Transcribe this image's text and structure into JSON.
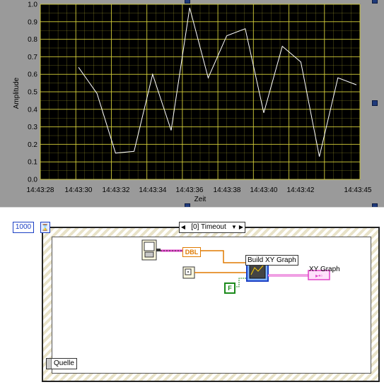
{
  "front_panel": {
    "graph_label": "XY Graph"
  },
  "chart_data": {
    "type": "line",
    "x": [
      "14:43:30",
      "14:43:31",
      "14:43:32",
      "14:43:33",
      "14:43:34",
      "14:43:35",
      "14:43:36",
      "14:43:37",
      "14:43:38",
      "14:43:39",
      "14:43:40",
      "14:43:41",
      "14:43:42",
      "14:43:43",
      "14:43:44",
      "14:43:45"
    ],
    "y": [
      0.64,
      0.49,
      0.15,
      0.16,
      0.6,
      0.28,
      0.98,
      0.58,
      0.82,
      0.86,
      0.38,
      0.76,
      0.67,
      0.13,
      0.58,
      0.54
    ],
    "xlabel": "Zeit",
    "ylabel": "Amplitude",
    "x_tick_labels": [
      "14:43:28",
      "14:43:30",
      "14:43:32",
      "14:43:34",
      "14:43:36",
      "14:43:38",
      "14:43:40",
      "14:43:42",
      "14:43:45"
    ],
    "y_tick_labels": [
      "0.0",
      "0.1",
      "0.2",
      "0.3",
      "0.4",
      "0.5",
      "0.6",
      "0.7",
      "0.8",
      "0.9",
      "1.0"
    ],
    "ylim": [
      0,
      1
    ],
    "grid": true,
    "colors": {
      "plot_bg": "#000000",
      "grid": "#d4cf3a",
      "trace": "#ffffff",
      "frame": "#9a9a9a"
    }
  },
  "diagram": {
    "timeout_value": "1000",
    "timeout_terminal": "⌛",
    "case_label": "[0] Timeout",
    "dbl_label": "DBL",
    "build_label": "Build XY Graph",
    "false_const": "F",
    "xy_graph_label": "XY Graph",
    "event_source_label": "Quelle",
    "wire_colors": {
      "orange": "#e07a00",
      "pink": "#e040c8",
      "green": "#1b8a1b",
      "blue": "#1b3fc4"
    }
  }
}
